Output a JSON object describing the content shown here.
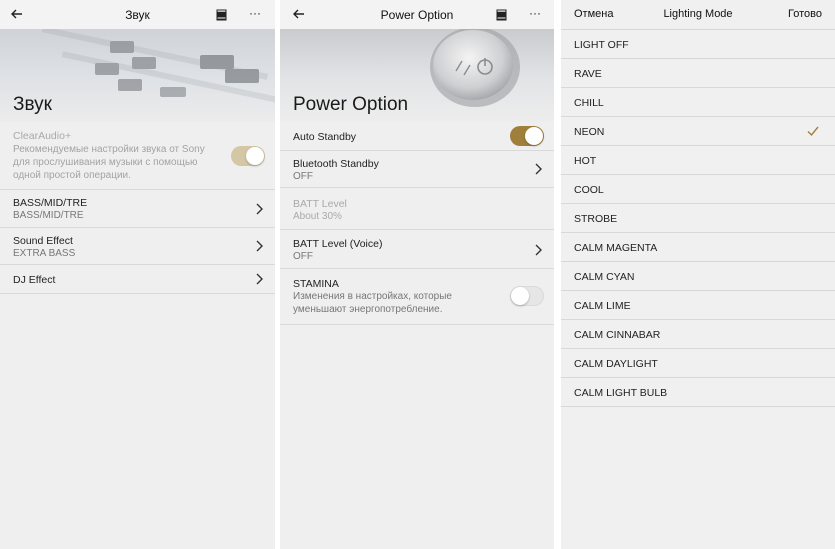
{
  "sound_panel": {
    "title": "Звук",
    "hero_title": "Звук",
    "clearaudio_label": "ClearAudio+",
    "clearaudio_desc": [
      "Рекомендуемые настройки звука от Sony",
      "для прослушивания музыки с помощью",
      "одной простой операции."
    ],
    "clearaudio_state": "on-disabled",
    "rows": [
      {
        "label": "BASS/MID/TRE",
        "value": "BASS/MID/TRE"
      },
      {
        "label": "Sound Effect",
        "value": "EXTRA BASS"
      },
      {
        "label": "DJ Effect",
        "value": ""
      }
    ]
  },
  "power_panel": {
    "title": "Power Option",
    "hero_title": "Power Option",
    "auto_standby_label": "Auto Standby",
    "auto_standby_state": "on",
    "bluetooth_standby": {
      "label": "Bluetooth Standby",
      "value": "OFF"
    },
    "batt_level": {
      "label": "BATT Level",
      "value": "About 30%"
    },
    "batt_level_voice": {
      "label": "BATT Level (Voice)",
      "value": "OFF"
    },
    "stamina": {
      "label": "STAMINA",
      "desc": [
        "Изменения в настройках, которые",
        "уменьшают энергопотребление."
      ],
      "state": "off"
    }
  },
  "lighting_panel": {
    "cancel_label": "Отмена",
    "title": "Lighting Mode",
    "done_label": "Готово",
    "selected": "NEON",
    "modes": [
      "LIGHT OFF",
      "RAVE",
      "CHILL",
      "NEON",
      "HOT",
      "COOL",
      "STROBE",
      "CALM MAGENTA",
      "CALM CYAN",
      "CALM LIME",
      "CALM CINNABAR",
      "CALM DAYLIGHT",
      "CALM LIGHT BULB"
    ]
  },
  "icons": {
    "back": "arrow-left-icon",
    "store": "store-icon",
    "more": "more-horizontal-icon",
    "chevron": "chevron-right-icon",
    "check": "checkmark-icon",
    "power": "power-button-icon"
  },
  "colors": {
    "accent": "#a07f3a",
    "background": "#efefef",
    "separator": "#d9d9d9"
  },
  "more_glyph": "···"
}
